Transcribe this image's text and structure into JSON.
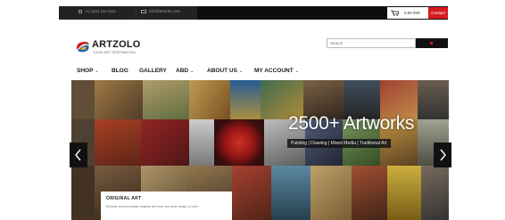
{
  "topbar": {
    "phone": "+1 (111) 111-1111",
    "email": "info@artzolo.com",
    "cart_label": "0.00 INR",
    "contact_label": "Contact"
  },
  "logo": {
    "brand": "ARTZOLO",
    "tagline": "YOUR ART DESTINATION"
  },
  "search": {
    "placeholder": "Search"
  },
  "nav": {
    "items": [
      {
        "label": "SHOP",
        "has_dropdown": true
      },
      {
        "label": "BLOG",
        "has_dropdown": false
      },
      {
        "label": "GALLERY",
        "has_dropdown": false
      },
      {
        "label": "ABD",
        "has_dropdown": true
      },
      {
        "label": "ABOUT US",
        "has_dropdown": true
      },
      {
        "label": "MY ACCOUNT",
        "has_dropdown": true
      }
    ]
  },
  "hero": {
    "headline": "2500+ Artworks",
    "categories": "Painting | Drawing | Mixed Media | Traditional Art"
  },
  "caption": {
    "title": "ORIGINAL ART",
    "text": "Browse and purchase original art from our wide range of over"
  },
  "colors": {
    "accent": "#d71920",
    "topbar_bg": "#0e0e0e"
  }
}
